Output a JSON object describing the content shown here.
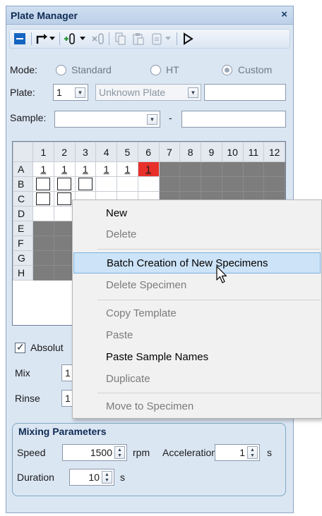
{
  "window": {
    "title": "Plate Manager",
    "close_glyph": "×"
  },
  "toolbar": {
    "icons": [
      "panel-icon",
      "transfer-icon",
      "dropdown-icon",
      "add-tube-icon",
      "dropdown-icon",
      "remove-tube-icon",
      "copy-icon",
      "paste-icon",
      "clipboard-icon",
      "dropdown-icon",
      "play-icon"
    ]
  },
  "mode": {
    "label": "Mode:",
    "options": [
      {
        "label": "Standard",
        "checked": false
      },
      {
        "label": "HT",
        "checked": false
      },
      {
        "label": "Custom",
        "checked": true
      }
    ]
  },
  "plate": {
    "label": "Plate:",
    "number": "1",
    "name_placeholder": "Unknown Plate",
    "extra_value": ""
  },
  "sample": {
    "label": "Sample:",
    "value": "",
    "dash": "-",
    "extra_value": ""
  },
  "grid": {
    "columns": [
      "1",
      "2",
      "3",
      "4",
      "5",
      "6",
      "7",
      "8",
      "9",
      "10",
      "11",
      "12"
    ],
    "rows": [
      "A",
      "B",
      "C",
      "D",
      "E",
      "F",
      "G",
      "H"
    ],
    "row_a_values": [
      "1",
      "1",
      "1",
      "1",
      "1",
      "1"
    ]
  },
  "options": {
    "absolute_label": "Absolut",
    "mix_label": "Mix",
    "mix_value": "1",
    "rinse_label": "Rinse",
    "rinse_value": "1"
  },
  "mixing": {
    "title": "Mixing Parameters",
    "speed_label": "Speed",
    "speed_value": "1500",
    "speed_unit": "rpm",
    "acceleration_label": "Acceleration",
    "acceleration_value": "1",
    "acceleration_unit": "s",
    "duration_label": "Duration",
    "duration_value": "10",
    "duration_unit": "s"
  },
  "context_menu": {
    "items": [
      {
        "label": "New",
        "enabled": true
      },
      {
        "label": "Delete",
        "enabled": false
      },
      {
        "label": "Batch Creation of New Specimens",
        "enabled": true,
        "highlighted": true
      },
      {
        "label": "Delete Specimen",
        "enabled": false
      },
      {
        "label": "Copy Template",
        "enabled": false
      },
      {
        "label": "Paste",
        "enabled": false
      },
      {
        "label": "Paste Sample Names",
        "enabled": true
      },
      {
        "label": "Duplicate",
        "enabled": false
      },
      {
        "label": "Move to Specimen",
        "enabled": false
      }
    ]
  },
  "colors": {
    "accent_blue": "#1565c0",
    "red_well": "#e8302a",
    "gray_well": "#7d7d7d",
    "highlight": "#cde3f7"
  }
}
